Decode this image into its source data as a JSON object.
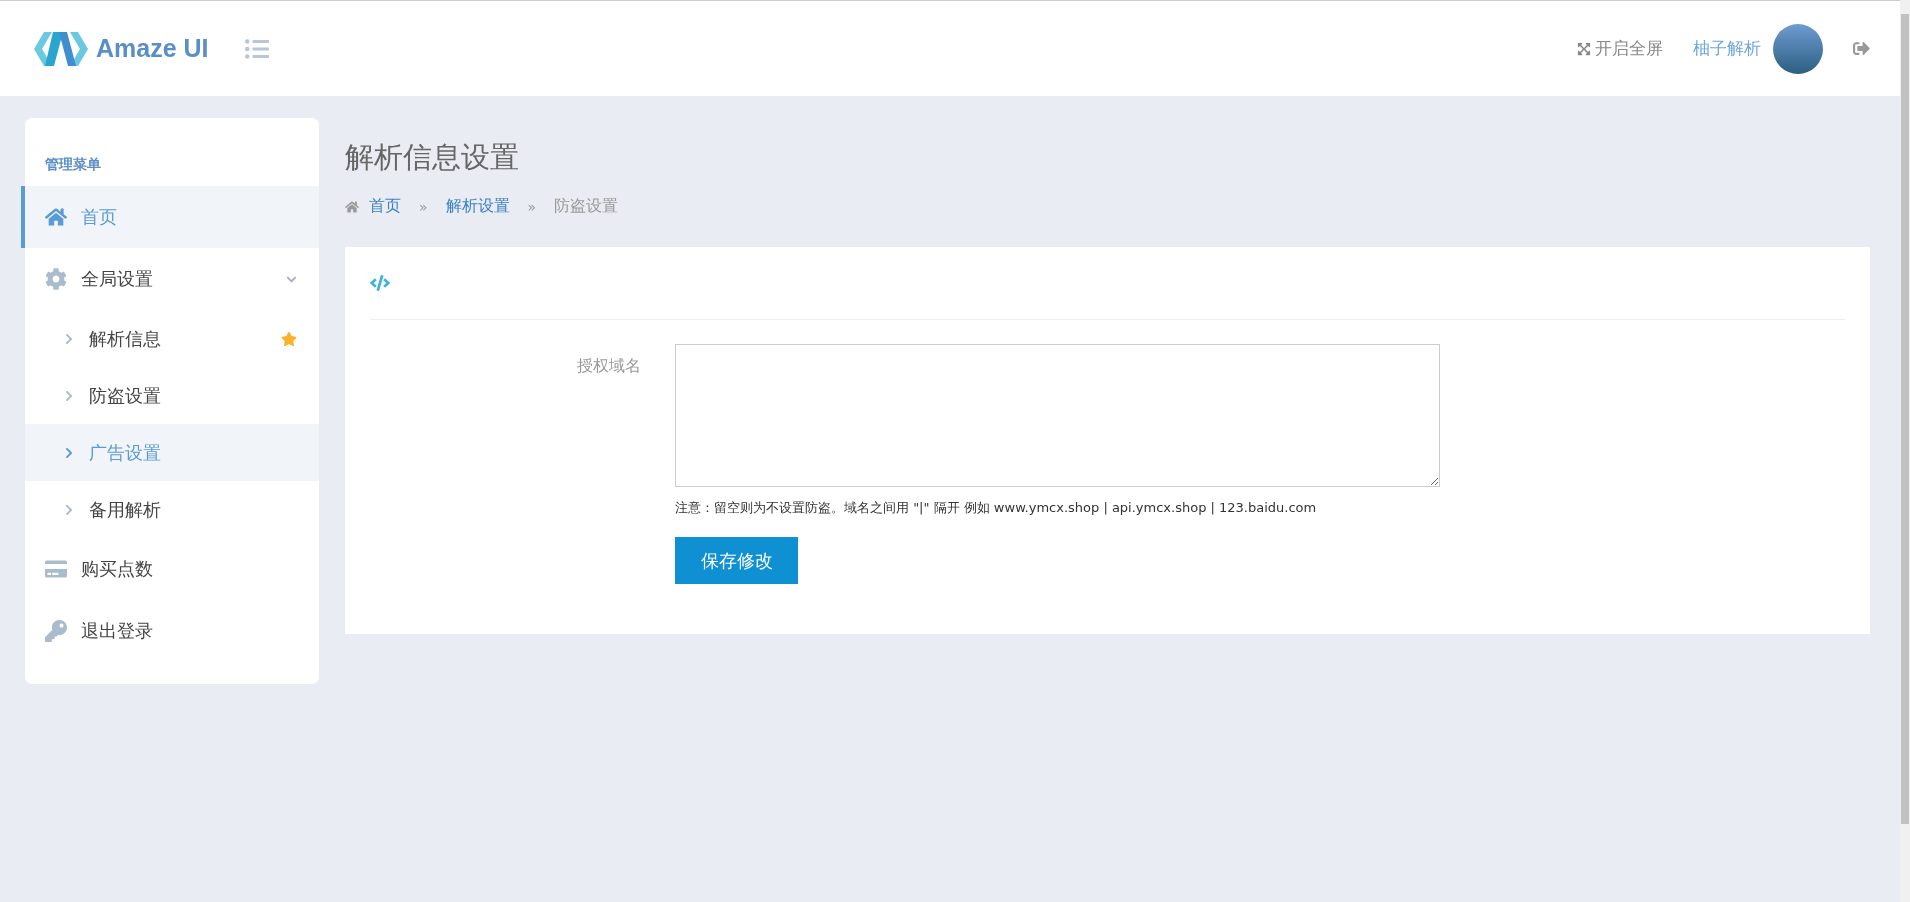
{
  "header": {
    "logo_text": "Amaze UI",
    "fullscreen_label": "开启全屏",
    "user_name": "柚子解析"
  },
  "sidebar": {
    "title": "管理菜单",
    "items": [
      {
        "kind": "home",
        "label": "首页",
        "selected": true
      },
      {
        "kind": "gear",
        "label": "全局设置",
        "selected": false,
        "expanded": true,
        "children": [
          {
            "label": "解析信息",
            "selected": false,
            "starred": true
          },
          {
            "label": "防盗设置",
            "selected": false,
            "starred": false
          },
          {
            "label": "广告设置",
            "selected": true,
            "starred": false
          },
          {
            "label": "备用解析",
            "selected": false,
            "starred": false
          }
        ]
      },
      {
        "kind": "card",
        "label": "购买点数",
        "selected": false
      },
      {
        "kind": "key",
        "label": "退出登录",
        "selected": false
      }
    ]
  },
  "page": {
    "title": "解析信息设置",
    "separator": "»",
    "breadcrumb": [
      {
        "kind": "home",
        "label": "首页"
      },
      {
        "kind": "link",
        "label": "解析设置"
      },
      {
        "kind": "current",
        "label": "防盗设置"
      }
    ]
  },
  "form": {
    "field_label": "授权域名",
    "note": "注意：留空则为不设置防盗。域名之间用 \"|\" 隔开 例如 www.ymcx.shop | api.ymcx.shop | 123.baidu.com",
    "submit": "保存修改"
  }
}
